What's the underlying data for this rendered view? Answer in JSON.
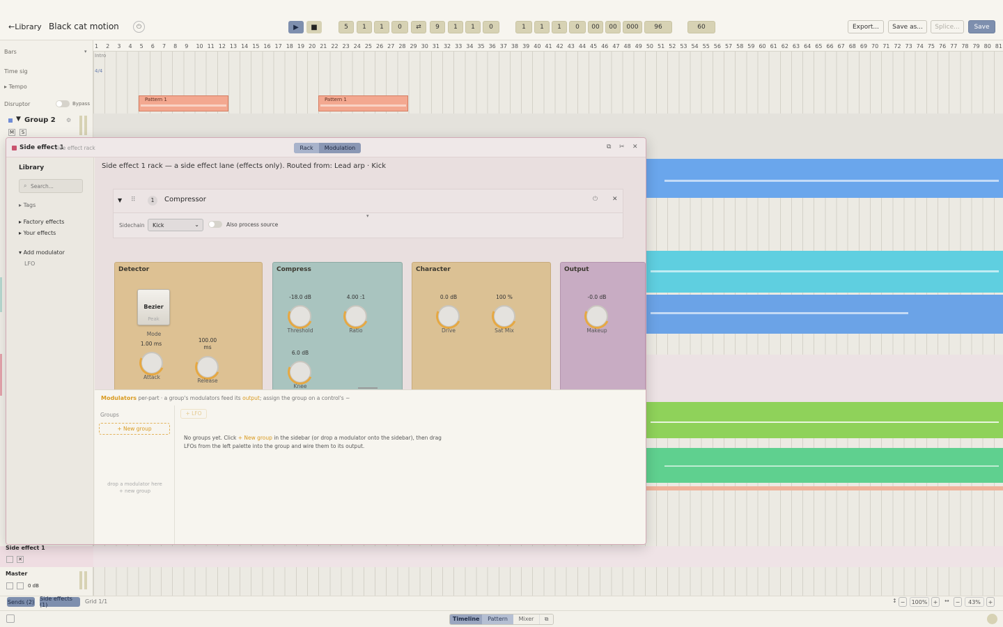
{
  "header": {
    "back_label": "Library",
    "project_title": "Black cat motion",
    "transport_position": [
      "5",
      "1",
      "1",
      "0"
    ],
    "loop_end": [
      "9",
      "1",
      "1",
      "0"
    ],
    "time_signature_cells": [
      "1",
      "1",
      "1",
      "0",
      "00",
      "00",
      "000",
      "96"
    ],
    "tempo": "60",
    "export_label": "Export...",
    "save_as_label": "Save as...",
    "splice_label": "Splice...",
    "save_label": "Save"
  },
  "tracks": {
    "bars_label": "Bars",
    "intro_marker": "Intro",
    "time_sig_label": "Time sig",
    "time_sig_value": "4/4",
    "tempo_label": "Tempo",
    "disruptor_label": "Disruptor",
    "bypass_label": "Bypass",
    "group_label": "Group 2",
    "group_buttons": [
      "M",
      "S"
    ],
    "side_effect_label": "Side effect 1",
    "master_label": "Master",
    "master_value": "0 dB",
    "pattern_labels": [
      "Pattern 1",
      "Pattern 1"
    ]
  },
  "rack": {
    "title": "Side effect 1",
    "subtitle": "side effect rack",
    "tabs": [
      "Rack",
      "Modulation"
    ],
    "description": "Side effect 1 rack — a side effect lane (effects only). Routed from: Lead arp · Kick",
    "library": {
      "title": "Library",
      "search_placeholder": "Search...",
      "tags": "Tags",
      "factory": "Factory effects",
      "yours": "Your effects",
      "add_modulator": "Add modulator",
      "lfo": "LFO"
    },
    "device": {
      "index": "1",
      "name": "Compressor",
      "sidechain_label": "Sidechain",
      "sidechain_value": "Kick",
      "also_process": "Also process source",
      "detector": {
        "title": "Detector",
        "mode_button": "Bezier",
        "mode_sub": "Peak",
        "mode_label": "Mode",
        "attack_value": "1.00 ms",
        "attack_label": "Attack",
        "release_value": "100.00",
        "release_unit": "ms",
        "release_label": "Release"
      },
      "compress": {
        "title": "Compress",
        "threshold_value": "-18.0 dB",
        "threshold_label": "Threshold",
        "ratio_value": "4.00 :1",
        "ratio_label": "Ratio",
        "knee_value": "6.0 dB",
        "knee_label": "Knee"
      },
      "character": {
        "title": "Character",
        "drive_value": "0.0 dB",
        "drive_label": "Drive",
        "satmix_value": "100 %",
        "satmix_label": "Sat Mix"
      },
      "output": {
        "title": "Output",
        "makeup_value": "-0.0 dB",
        "makeup_label": "Makeup"
      }
    },
    "modulators": {
      "title": "Modulators",
      "hint_a": "per-part · a group's modulators feed its",
      "hint_output": "output",
      "hint_b": "; assign the group on a control's ~",
      "groups_label": "Groups",
      "new_group": "+ New group",
      "lfo_chip": "+ LFO",
      "empty_a": "No groups yet. Click",
      "empty_link": "+ New group",
      "empty_b": "in the sidebar (or drop a modulator onto the sidebar), then drag",
      "empty_c": "LFOs from the left palette into the group and wire them to its output.",
      "drop_a": "drop a modulator here",
      "drop_b": "+ new group"
    }
  },
  "bottom": {
    "sends": "Sends (2)",
    "side_effects": "Side effects (1)",
    "grid": "Grid 1/1",
    "zoom_h": "100%",
    "zoom_v": "43%"
  },
  "footer": {
    "tabs": [
      "Timeline",
      "Pattern",
      "Mixer"
    ]
  }
}
